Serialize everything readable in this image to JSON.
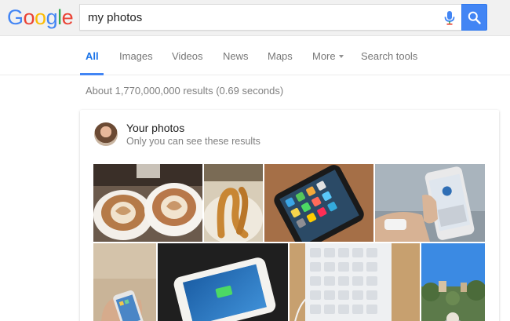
{
  "header": {
    "logo_letters": [
      {
        "ch": "G",
        "color": "#4285f4"
      },
      {
        "ch": "o",
        "color": "#ea4335"
      },
      {
        "ch": "o",
        "color": "#fbbc05"
      },
      {
        "ch": "g",
        "color": "#4285f4"
      },
      {
        "ch": "l",
        "color": "#34a853"
      },
      {
        "ch": "e",
        "color": "#ea4335"
      }
    ],
    "search_value": "my photos",
    "accent_color": "#4285f4"
  },
  "tabs": [
    {
      "label": "All",
      "active": true
    },
    {
      "label": "Images",
      "active": false
    },
    {
      "label": "Videos",
      "active": false
    },
    {
      "label": "News",
      "active": false
    },
    {
      "label": "Maps",
      "active": false
    },
    {
      "label": "More",
      "active": false,
      "icon": "caret-down-icon"
    },
    {
      "label": "Search tools",
      "active": false
    }
  ],
  "result_stats": "About 1,770,000,000 results (0.69 seconds)",
  "photos_card": {
    "title": "Your photos",
    "subtitle": "Only you can see these results",
    "photos": [
      {
        "subject": "latte-art-coffee-cups"
      },
      {
        "subject": "churros-pastry"
      },
      {
        "subject": "iphone-home-screen"
      },
      {
        "subject": "hand-holding-iphone"
      },
      {
        "subject": "hand-with-small-iphone"
      },
      {
        "subject": "iphone-in-battery-case-charging"
      },
      {
        "subject": "white-keyboard"
      },
      {
        "subject": "city-street-trees-blue-sky"
      }
    ]
  }
}
